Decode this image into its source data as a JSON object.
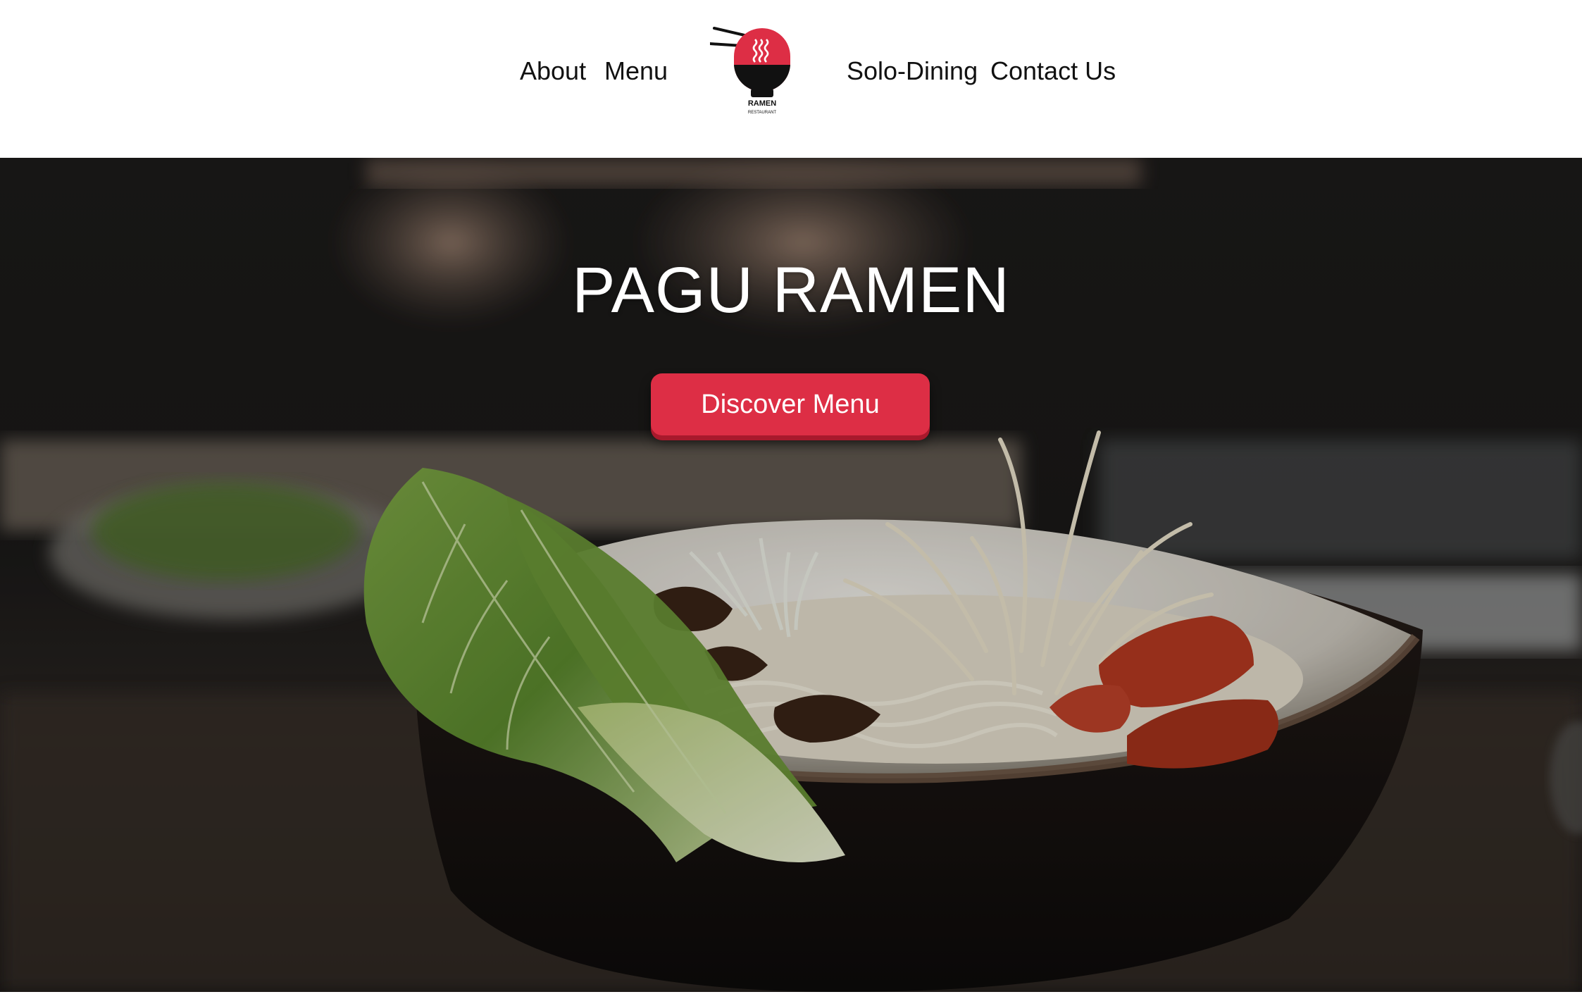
{
  "nav": {
    "left": [
      {
        "label": "About"
      },
      {
        "label": "Menu"
      }
    ],
    "right": [
      {
        "label": "Solo-Dining"
      },
      {
        "label": "Contact Us"
      }
    ]
  },
  "logo": {
    "text_main": "RAMEN",
    "text_sub": "RESTAURANT",
    "icon": "ramen-bowl-chopsticks-icon",
    "colors": {
      "red": "#dd2e45",
      "black": "#111111"
    }
  },
  "hero": {
    "title": "PAGU RAMEN",
    "cta_label": "Discover Menu",
    "image": "ramen-bowl-photo",
    "colors": {
      "button": "#dd2e45",
      "button_shadow": "#a8192c",
      "title": "#ffffff"
    }
  }
}
